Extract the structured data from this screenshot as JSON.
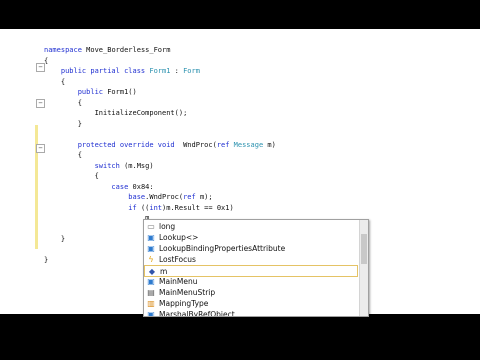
{
  "editor": {
    "lines": [
      {
        "parts": [
          {
            "t": "namespace ",
            "k": "kw"
          },
          {
            "t": "Move_Borderless_Form",
            "k": ""
          }
        ]
      },
      {
        "parts": [
          {
            "t": "{",
            "k": ""
          }
        ]
      },
      {
        "parts": [
          {
            "t": "    public partial class ",
            "k": "kw"
          },
          {
            "t": "Form1",
            "k": "ty"
          },
          {
            "t": " : ",
            "k": ""
          },
          {
            "t": "Form",
            "k": "ty"
          }
        ]
      },
      {
        "parts": [
          {
            "t": "    {",
            "k": ""
          }
        ]
      },
      {
        "parts": [
          {
            "t": "        public ",
            "k": "kw"
          },
          {
            "t": "Form1()",
            "k": ""
          }
        ]
      },
      {
        "parts": [
          {
            "t": "        {",
            "k": ""
          }
        ]
      },
      {
        "parts": [
          {
            "t": "            InitializeComponent();",
            "k": ""
          }
        ]
      },
      {
        "parts": [
          {
            "t": "        }",
            "k": ""
          }
        ]
      },
      {
        "parts": [
          {
            "t": "",
            "k": ""
          }
        ]
      },
      {
        "parts": [
          {
            "t": "        protected override void ",
            "k": "kw"
          },
          {
            "t": " WndProc(",
            "k": ""
          },
          {
            "t": "ref ",
            "k": "kw"
          },
          {
            "t": "Message",
            "k": "ty"
          },
          {
            "t": " m)",
            "k": ""
          }
        ]
      },
      {
        "parts": [
          {
            "t": "        {",
            "k": ""
          }
        ]
      },
      {
        "parts": [
          {
            "t": "            switch ",
            "k": "kw"
          },
          {
            "t": "(m.Msg)",
            "k": ""
          }
        ]
      },
      {
        "parts": [
          {
            "t": "            {",
            "k": ""
          }
        ]
      },
      {
        "parts": [
          {
            "t": "                case ",
            "k": "kw"
          },
          {
            "t": "0x84:",
            "k": ""
          }
        ]
      },
      {
        "parts": [
          {
            "t": "                    base",
            "k": "kw"
          },
          {
            "t": ".WndProc(",
            "k": ""
          },
          {
            "t": "ref ",
            "k": "kw"
          },
          {
            "t": "m);",
            "k": ""
          }
        ]
      },
      {
        "parts": [
          {
            "t": "                    if ",
            "k": "kw"
          },
          {
            "t": "((",
            "k": ""
          },
          {
            "t": "int",
            "k": "kw"
          },
          {
            "t": ")m.Result == 0x1)",
            "k": ""
          }
        ]
      },
      {
        "parts": [
          {
            "t": "                        m",
            "k": ""
          }
        ]
      },
      {
        "parts": [
          {
            "t": "",
            "k": ""
          }
        ]
      },
      {
        "parts": [
          {
            "t": "    }",
            "k": ""
          }
        ]
      },
      {
        "parts": [
          {
            "t": "",
            "k": ""
          }
        ]
      },
      {
        "parts": [
          {
            "t": "}",
            "k": ""
          }
        ]
      }
    ]
  },
  "completion": {
    "items": [
      {
        "label": "long",
        "icon": "keyword-icon",
        "glyph": "▭",
        "color": "#777777"
      },
      {
        "label": "Lookup<>",
        "icon": "class-icon",
        "glyph": "▣",
        "color": "#2e7bcf"
      },
      {
        "label": "LookupBindingPropertiesAttribute",
        "icon": "class-icon",
        "glyph": "▣",
        "color": "#2e7bcf"
      },
      {
        "label": "LostFocus",
        "icon": "event-icon",
        "glyph": "ϟ",
        "color": "#e0a010"
      },
      {
        "label": "m",
        "icon": "local-variable-icon",
        "glyph": "◆",
        "color": "#3355aa"
      },
      {
        "label": "MainMenu",
        "icon": "class-icon",
        "glyph": "▣",
        "color": "#2e7bcf"
      },
      {
        "label": "MainMenuStrip",
        "icon": "property-icon",
        "glyph": "▤",
        "color": "#555555"
      },
      {
        "label": "MappingType",
        "icon": "enum-icon",
        "glyph": "▥",
        "color": "#d88a18"
      },
      {
        "label": "MarshalByRefObject",
        "icon": "class-icon",
        "glyph": "▣",
        "color": "#2e7bcf"
      }
    ],
    "selected_index": 4
  }
}
